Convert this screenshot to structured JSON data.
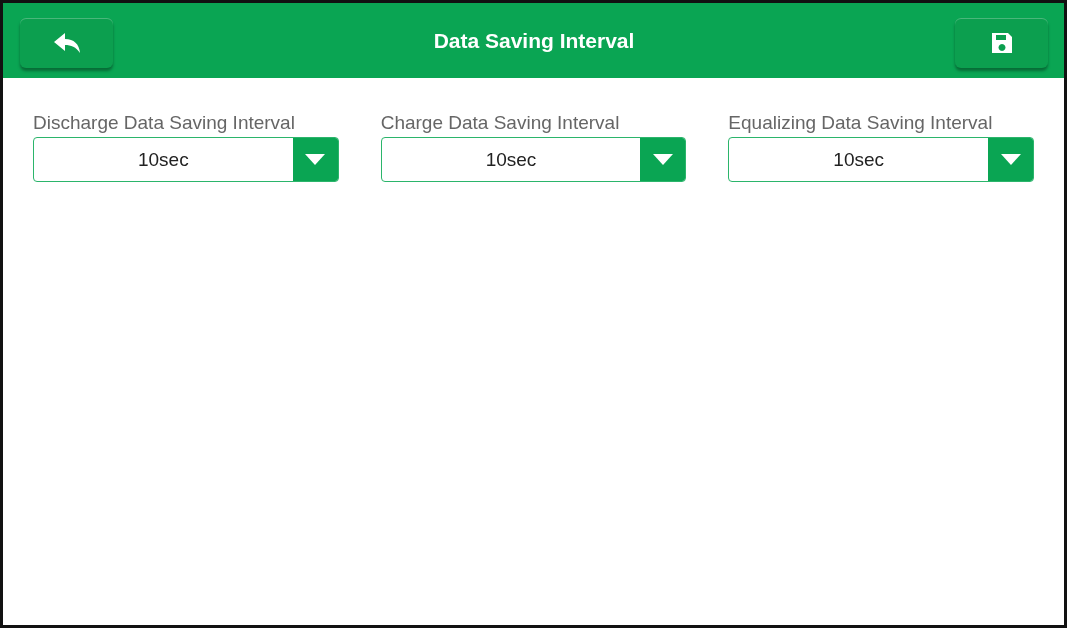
{
  "header": {
    "title": "Data Saving Interval"
  },
  "fields": [
    {
      "label": "Discharge Data Saving Interval",
      "value": "10sec"
    },
    {
      "label": "Charge Data Saving Interval",
      "value": "10sec"
    },
    {
      "label": "Equalizing Data Saving Interval",
      "value": "10sec"
    }
  ]
}
